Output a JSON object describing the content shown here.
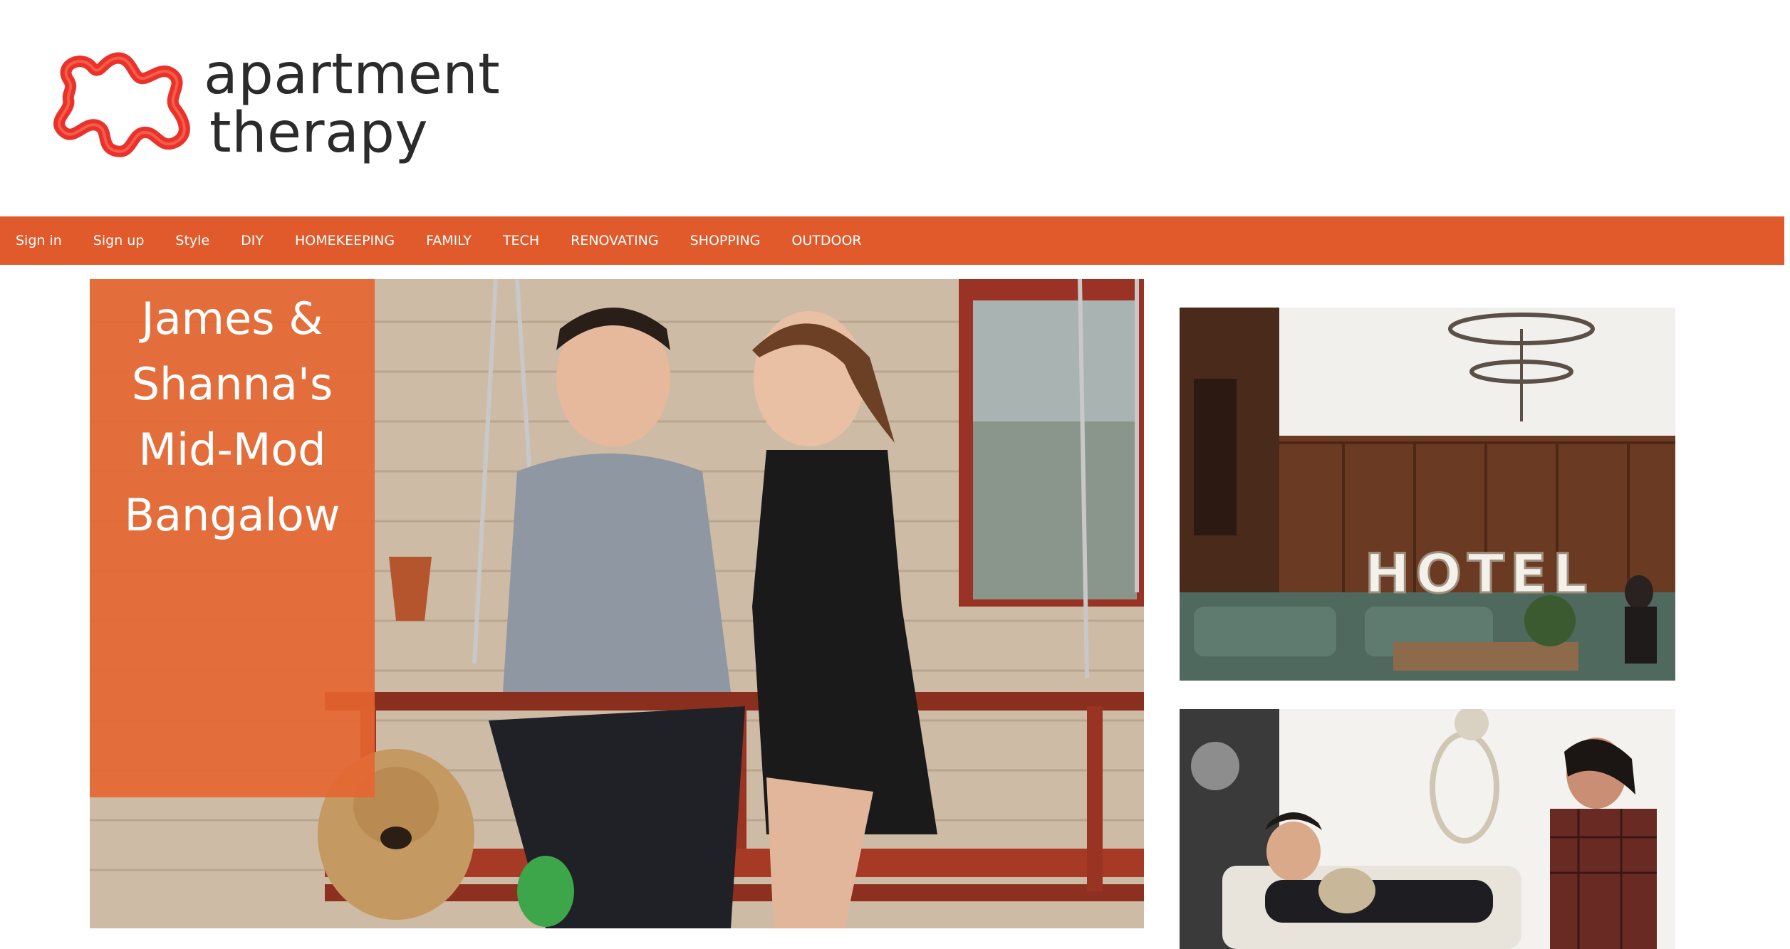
{
  "brand": {
    "name_line1": "apartment",
    "name_line2": "therapy",
    "logo_color": "#e8322b",
    "text_color": "#2b2b2b"
  },
  "nav": {
    "background": "#e05a2b",
    "items": [
      {
        "label": "Sign in"
      },
      {
        "label": "Sign up"
      },
      {
        "label": "Style"
      },
      {
        "label": "DIY"
      },
      {
        "label": "HOMEKEEPING"
      },
      {
        "label": "FAMILY"
      },
      {
        "label": "TECH"
      },
      {
        "label": "RENOVATING"
      },
      {
        "label": "SHOPPING"
      },
      {
        "label": "OUTDOOR"
      }
    ]
  },
  "hero": {
    "title_lines": [
      "James &",
      "Shanna's",
      "Mid-Mod",
      "Bangalow"
    ],
    "overlay_color": "#e56530"
  },
  "cards": [
    {
      "sign_text": "HOTEL"
    },
    {}
  ]
}
